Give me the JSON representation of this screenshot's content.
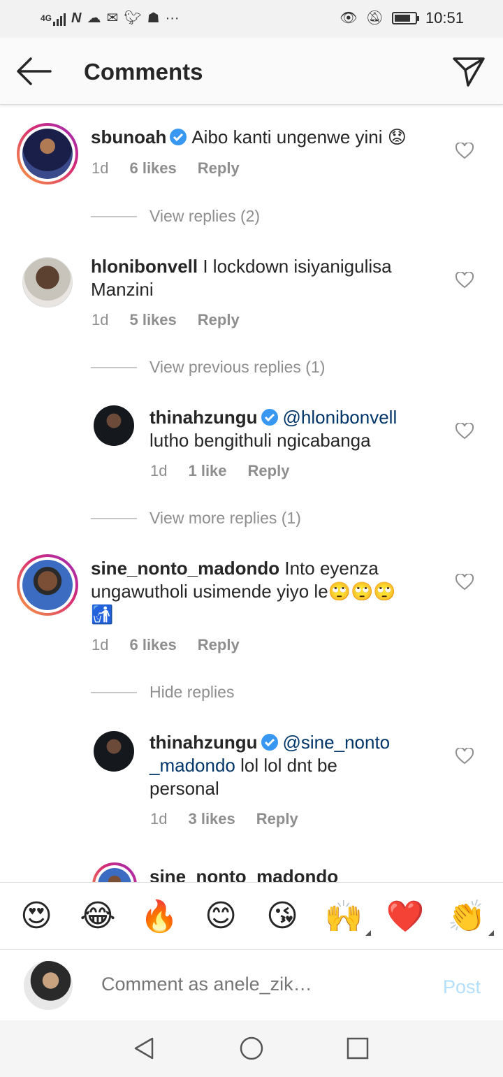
{
  "status_bar": {
    "network": "4G",
    "time": "10:51",
    "icons": [
      "signal-icon",
      "netflix-icon",
      "cloud-icon",
      "mail-icon",
      "twitter-icon",
      "app-icon",
      "more-icon",
      "eye-icon",
      "bell-off-icon",
      "battery-icon"
    ]
  },
  "header": {
    "title": "Comments",
    "back_icon": "back-arrow-icon",
    "send_icon": "direct-message-icon"
  },
  "comments": [
    {
      "username": "sbunoah",
      "verified": true,
      "text": "Aibo kanti ungenwe yini 😟",
      "time": "1d",
      "likes": "6 likes",
      "reply": "Reply",
      "view_replies": "View replies (2)"
    },
    {
      "username": "hlonibonvell",
      "verified": false,
      "text_line1": "I lockdown isiyanigulisa",
      "text_line2": "Manzini",
      "time": "1d",
      "likes": "5 likes",
      "reply": "Reply",
      "view_previous": "View previous replies (1)"
    },
    {
      "username": "thinahzungu",
      "verified": true,
      "mention": "@hlonibonvell",
      "text": "lutho bengithuli ngicabanga",
      "time": "1d",
      "likes": "1 like",
      "reply": "Reply",
      "view_more": "View more replies (1)"
    },
    {
      "username": "sine_nonto_madondo",
      "verified": false,
      "text_line1": "Into eyenza",
      "text_line2": "ungawutholi usimende yiyo le🙄🙄🙄",
      "text_line3": "🚮",
      "time": "1d",
      "likes": "6 likes",
      "reply": "Reply",
      "hide_replies": "Hide replies"
    },
    {
      "username": "thinahzungu",
      "verified": true,
      "mention_line1": "@sine_nonto",
      "mention_line2": "_madondo",
      "text_line2": " lol lol dnt be",
      "text_line3": "personal",
      "time": "1d",
      "likes": "3 likes",
      "reply": "Reply"
    },
    {
      "username": "sine_nonto_madondo"
    }
  ],
  "emoji_bar": [
    "😍",
    "😂",
    "🔥",
    "😊",
    "😘",
    "🙌",
    "❤️",
    "👏"
  ],
  "input": {
    "placeholder": "Comment as anele_zik…",
    "post_label": "Post"
  },
  "navbar": {
    "back": "nav-back-icon",
    "home": "nav-home-icon",
    "recents": "nav-recents-icon"
  },
  "colors": {
    "header_bg": "#fafafa",
    "verified_blue": "#3897f0",
    "mention": "#003569",
    "meta_gray": "#8e8e8e",
    "post_disabled": "#b2dffc"
  }
}
